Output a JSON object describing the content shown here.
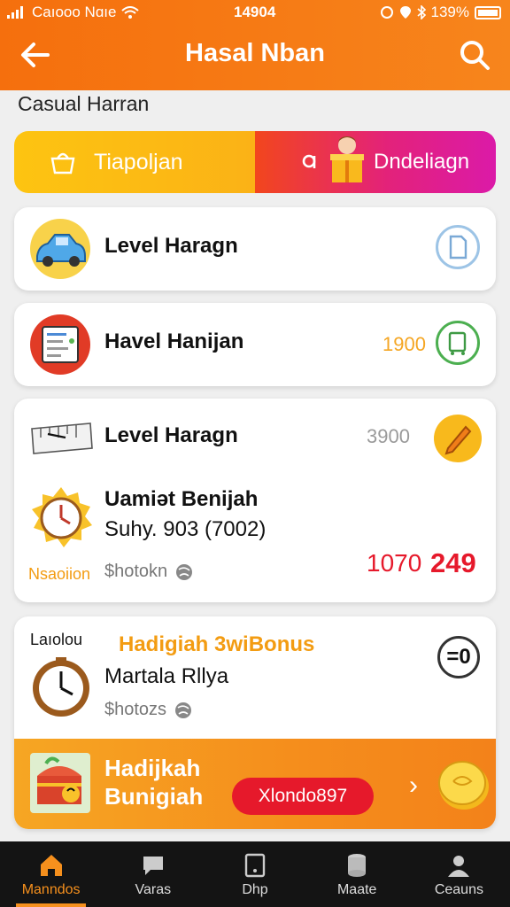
{
  "status_bar": {
    "carrier": "Caıooo Nɑıe",
    "time": "14904",
    "battery": "139%"
  },
  "header": {
    "title": "Hasal Nban",
    "back_icon": "arrow-left-icon",
    "search_icon": "search-icon"
  },
  "section": {
    "label": "Casual Harran"
  },
  "tabs": [
    {
      "label": "Tiapoljan",
      "icon": "basket-icon"
    },
    {
      "label": "Dndeliagn",
      "icon": "gift-box-icon"
    }
  ],
  "rows": [
    {
      "title": "Level Haragn",
      "icon": "car-icon",
      "action_icon": "document-icon"
    },
    {
      "title": "Havel Hanijan",
      "icon": "checklist-icon",
      "value": "1900",
      "action_icon": "trolley-icon"
    },
    {
      "title": "Level Haragn",
      "icon": "ruler-icon",
      "value": "3900",
      "action_icon": "pencil-icon"
    }
  ],
  "timer_block": {
    "title": "Uamiət Benijah",
    "subtitle": "Suhy. 903 (7002)",
    "tag": "Nsaoiion",
    "shared_label": "$hotokn",
    "value_a": "1070",
    "value_b": "249"
  },
  "bonus_block": {
    "overline": "Laıolou",
    "title": "Hadigiah 3wiBonus",
    "subtitle": "Martala Rllya",
    "shared_label": "$hotozs",
    "badge": "=0"
  },
  "banner": {
    "line1": "Hadijkah",
    "line2": "Bunigiah",
    "code": "Xlondo897",
    "chevron": "›"
  },
  "nav": [
    {
      "label": "Manndos",
      "icon": "home-icon",
      "active": true
    },
    {
      "label": "Varas",
      "icon": "chat-icon",
      "active": false
    },
    {
      "label": "Dhp",
      "icon": "tablet-icon",
      "active": false
    },
    {
      "label": "Maate",
      "icon": "cylinder-icon",
      "active": false
    },
    {
      "label": "Ceauns",
      "icon": "user-icon",
      "active": false
    }
  ],
  "colors": {
    "brand_orange": "#f6901d",
    "tab_yellow": "#fdc411",
    "tab_pink": "#e3227a",
    "value_red": "#e6192b"
  }
}
